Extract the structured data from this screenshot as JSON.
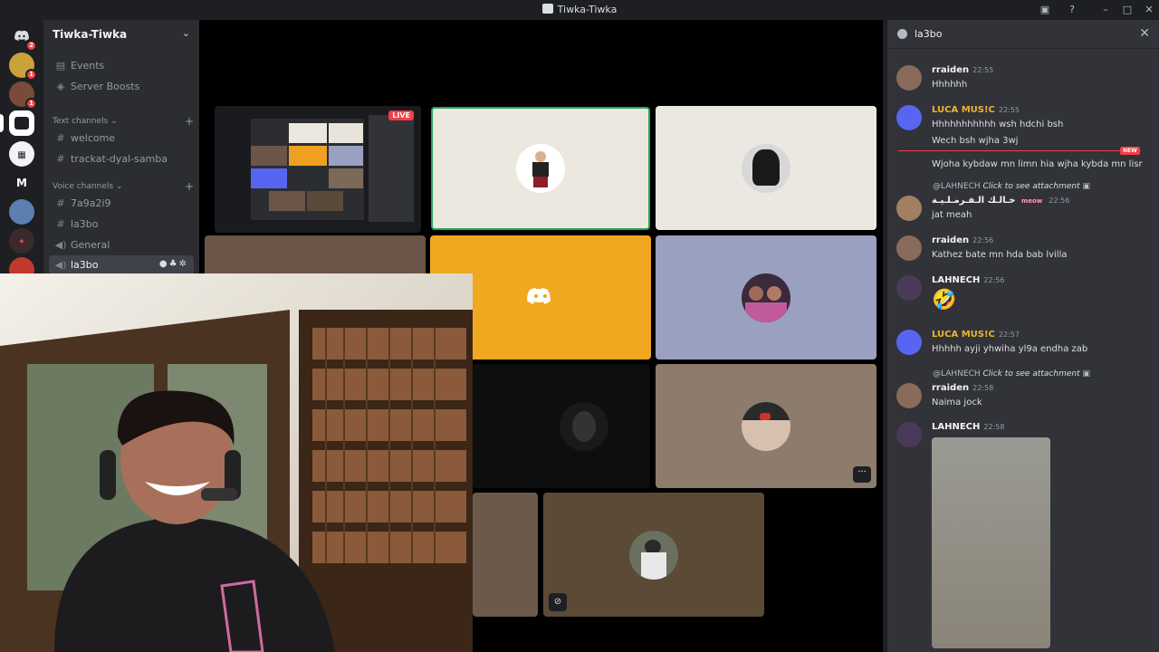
{
  "window": {
    "title": "Tiwka-Tiwka"
  },
  "rail": {
    "servers": [
      {
        "label": "",
        "badge": "2"
      },
      {
        "label": "",
        "badge": "1"
      },
      {
        "label": "",
        "badge": "1"
      },
      {
        "label": "",
        "badge": ""
      },
      {
        "label": "",
        "badge": ""
      },
      {
        "label": "M",
        "badge": ""
      },
      {
        "label": "",
        "badge": ""
      },
      {
        "label": "",
        "badge": ""
      },
      {
        "label": "",
        "badge": ""
      }
    ]
  },
  "guild": {
    "name": "Tiwka-Tiwka",
    "top_items": [
      "Events",
      "Server Boosts"
    ],
    "text_category": "Text channels",
    "text_channels": [
      "welcome",
      "trackat-dyal-samba"
    ],
    "voice_category": "Voice channels",
    "voice_channels": [
      "7a9a2i9",
      "la3bo",
      "General",
      "la3bo"
    ]
  },
  "stage": {
    "live_label": "LIVE"
  },
  "chat": {
    "channel": "la3bo",
    "new_label": "NEW",
    "messages": [
      {
        "author": "rraiden",
        "time": "22:55",
        "lines": [
          "Hhhhhh"
        ]
      },
      {
        "author": "LUCA MUS!C",
        "time": "22:55",
        "lines": [
          "Hhhhhhhhhhh wsh hdchi bsh",
          "Wech bsh wjha 3wj",
          "Wjoha kybdaw mn limn hia wjha kybda mn lisr"
        ]
      },
      {
        "reply": "@LAHNECH",
        "reply_note": "Click to see attachment",
        "author": "خـالـك الـفـرمـلـيـة",
        "tag": "meow",
        "time": "22:56",
        "lines": [
          "jat meah"
        ]
      },
      {
        "author": "rraiden",
        "time": "22:56",
        "lines": [
          "Kathez bate mn hda bab lvilla"
        ]
      },
      {
        "author": "LAHNECH",
        "time": "22:56",
        "lines": [
          "🤣"
        ]
      },
      {
        "author": "LUCA MUS!C",
        "time": "22:57",
        "lines": [
          "Hhhhh ayji yhwiha yl9a endha zab"
        ]
      },
      {
        "reply": "@LAHNECH",
        "reply_note": "Click to see attachment",
        "author": "rraiden",
        "time": "22:58",
        "lines": [
          "Naima jock"
        ]
      },
      {
        "author": "LAHNECH",
        "time": "22:58",
        "lines": []
      }
    ]
  }
}
